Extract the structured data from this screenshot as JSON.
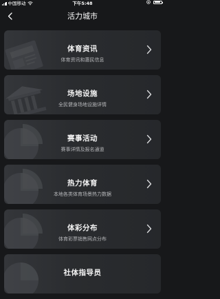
{
  "status_bar": {
    "carrier": "中国移动",
    "time": "下午5:48"
  },
  "nav": {
    "title": "活力城市"
  },
  "cards": [
    {
      "title": "体育资讯",
      "subtitle": "体育资讯和惠民信息",
      "art": "newspaper-illustration"
    },
    {
      "title": "场地设施",
      "subtitle": "全民健身场地设施详情",
      "art": "stadium-building-illustration"
    },
    {
      "title": "赛事活动",
      "subtitle": "赛事详情及报名通道",
      "art": "pie-chart-illustration"
    },
    {
      "title": "热力体育",
      "subtitle": "本地各类体育场景热力数据",
      "art": "pie-chart-illustration"
    },
    {
      "title": "体彩分布",
      "subtitle": "体育彩票销售网点分布",
      "art": "pie-chart-illustration"
    },
    {
      "title": "社体指导员",
      "subtitle": "",
      "art": "pie-chart-illustration"
    }
  ]
}
